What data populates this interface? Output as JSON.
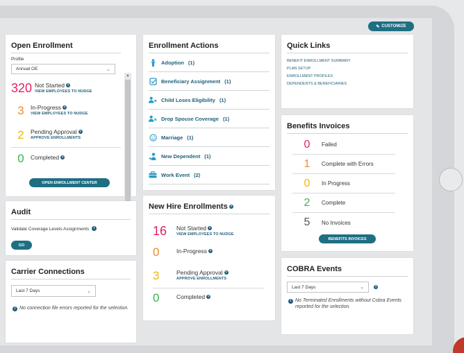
{
  "toolbar": {
    "customize_label": "CUSTOMIZE"
  },
  "open_enrollment": {
    "title": "Open Enrollment",
    "profile_label": "Profile",
    "profile_value": "Annual OE",
    "stats": [
      {
        "value": "320",
        "label": "Not Started",
        "sub": "VIEW EMPLOYEES TO NUDGE",
        "color": "#e0245e"
      },
      {
        "value": "3",
        "label": "In-Progress",
        "sub": "VIEW EMPLOYEES TO NUDGE",
        "color": "#f28c28"
      },
      {
        "value": "2",
        "label": "Pending Approval",
        "sub": "APPROVE ENROLLMENTS",
        "color": "#f2b705"
      },
      {
        "value": "0",
        "label": "Completed",
        "sub": "",
        "color": "#3cb44b"
      }
    ],
    "button_label": "OPEN ENROLLMENT CENTER"
  },
  "audit": {
    "title": "Audit",
    "text": "Validate Coverage Levels Assignments",
    "button_label": "GO"
  },
  "carrier": {
    "title": "Carrier Connections",
    "range_value": "Last 7 Days",
    "note": "No connection file errors reported for the selection."
  },
  "enrollment_actions": {
    "title": "Enrollment Actions",
    "items": [
      {
        "label": "Adoption",
        "count": "(1)",
        "icon": "person-icon"
      },
      {
        "label": "Beneficiary Assignment",
        "count": "(1)",
        "icon": "checkbox-icon"
      },
      {
        "label": "Child Loses Eligibility",
        "count": "(1)",
        "icon": "person-remove-icon"
      },
      {
        "label": "Drop Spouse Coverage",
        "count": "(1)",
        "icon": "person-remove-icon"
      },
      {
        "label": "Marriage",
        "count": "(1)",
        "icon": "smiley-icon"
      },
      {
        "label": "New Dependent",
        "count": "(1)",
        "icon": "person-add-icon"
      },
      {
        "label": "Work Event",
        "count": "(2)",
        "icon": "briefcase-icon"
      }
    ]
  },
  "new_hire": {
    "title": "New Hire Enrollments",
    "stats": [
      {
        "value": "16",
        "label": "Not Started",
        "sub": "VIEW EMPLOYEES TO NUDGE",
        "color": "#e0245e"
      },
      {
        "value": "0",
        "label": "In-Progress",
        "sub": "",
        "color": "#f28c28"
      },
      {
        "value": "3",
        "label": "Pending Approval",
        "sub": "APPROVE ENROLLMENTS",
        "color": "#f2b705"
      },
      {
        "value": "0",
        "label": "Completed",
        "sub": "",
        "color": "#3cb44b"
      }
    ]
  },
  "quick_links": {
    "title": "Quick Links",
    "links": [
      "BENEFIT ENROLLMENT SUMMARY",
      "PLAN SETUP",
      "ENROLLMENT PROFILES",
      "DEPENDENTS & BENEFICIARIES"
    ]
  },
  "invoices": {
    "title": "Benefits Invoices",
    "rows": [
      {
        "value": "0",
        "label": "Failed",
        "color": "#e0245e"
      },
      {
        "value": "1",
        "label": "Complete with Errors",
        "color": "#f28c28"
      },
      {
        "value": "0",
        "label": "In Progress",
        "color": "#f2b705"
      },
      {
        "value": "2",
        "label": "Complete",
        "color": "#3cb44b"
      },
      {
        "value": "5",
        "label": "No Invoices",
        "color": "#555555"
      }
    ],
    "button_label": "BENEFITS INVOICES"
  },
  "cobra": {
    "title": "COBRA Events",
    "range_value": "Last 7 Days",
    "note": "No Terminated Enrollments without Cobra Events reported for the selection."
  }
}
